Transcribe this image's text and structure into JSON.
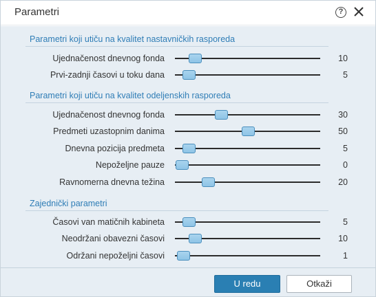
{
  "window": {
    "title": "Parametri",
    "help_icon": "question-circle-icon",
    "close_icon": "close-icon",
    "help_glyph": "?"
  },
  "sections": [
    {
      "title": "Parametri koji utiču na kvalitet nastavničkih rasporeda",
      "rows": [
        {
          "label": "Ujednačenost dnevnog fonda",
          "value": "10"
        },
        {
          "label": "Prvi-zadnji časovi u toku dana",
          "value": "5"
        }
      ]
    },
    {
      "title": "Parametri koji utiču na kvalitet odeljenskih rasporeda",
      "rows": [
        {
          "label": "Ujednačenost dnevnog fonda",
          "value": "30"
        },
        {
          "label": "Predmeti uzastopnim danima",
          "value": "50"
        },
        {
          "label": "Dnevna pozicija predmeta",
          "value": "5"
        },
        {
          "label": "Nepoželjne pauze",
          "value": "0"
        },
        {
          "label": "Ravnomerna dnevna težina",
          "value": "20"
        }
      ]
    },
    {
      "title": "Zajednički parametri",
      "rows": [
        {
          "label": "Časovi van matičnih kabineta",
          "value": "5"
        },
        {
          "label": "Neodržani obavezni časovi",
          "value": "10"
        },
        {
          "label": "Održani nepoželjni časovi",
          "value": "1"
        }
      ]
    }
  ],
  "slider_scale": {
    "min": 0,
    "max": 100
  },
  "buttons": {
    "ok": "U redu",
    "cancel": "Otkaži"
  },
  "colors": {
    "accent": "#2a7fb3",
    "section_title": "#2f7db6",
    "panel_bg": "#e7eef4",
    "thumb": "#a9d4ee"
  }
}
